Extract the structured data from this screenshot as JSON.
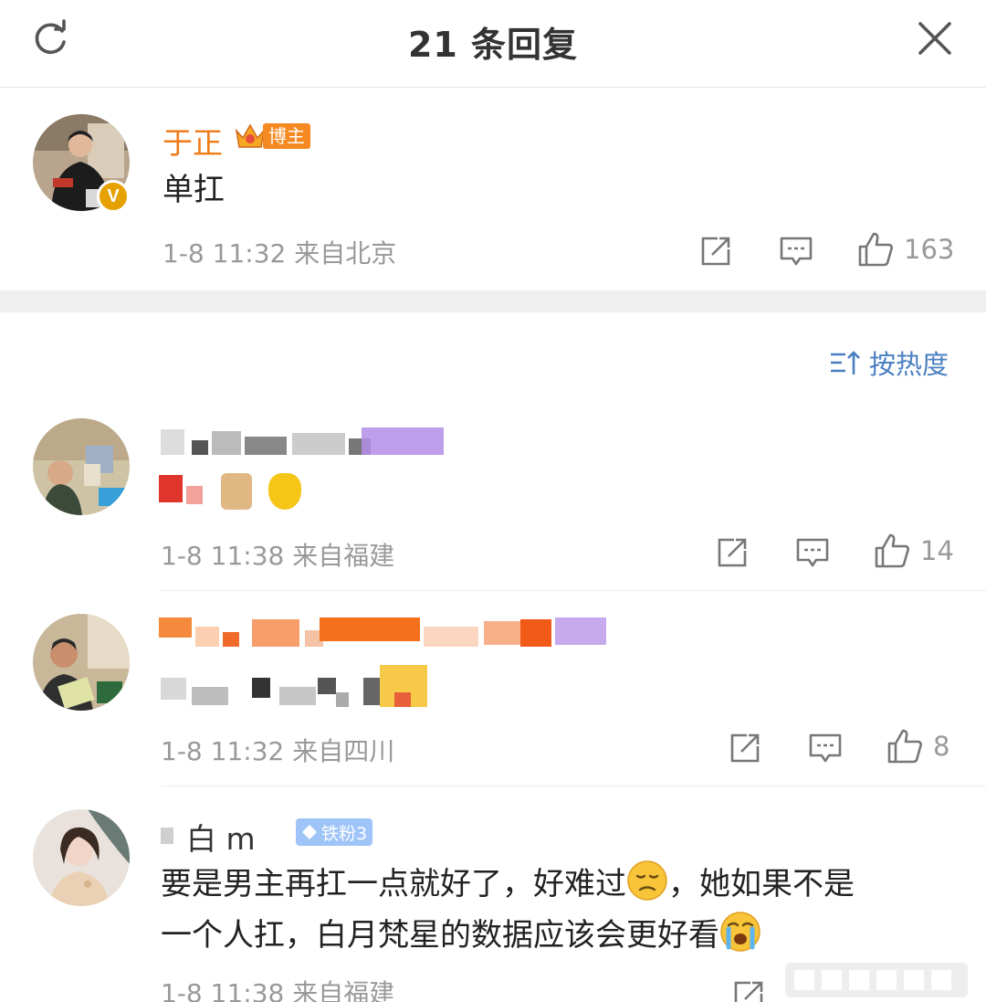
{
  "header": {
    "title": "21 条回复",
    "refresh_icon": "refresh-icon",
    "close_icon": "close-icon"
  },
  "main_comment": {
    "username": "于正",
    "badge": "博主",
    "verified_mark": "V",
    "text": "单扛",
    "meta": "1-8 11:32  来自北京",
    "likes": "163"
  },
  "sort": {
    "label": "按热度"
  },
  "replies": [
    {
      "meta": "1-8 11:38  来自福建",
      "likes": "14"
    },
    {
      "meta": "1-8 11:32  来自四川",
      "likes": "8"
    },
    {
      "username": "白 m",
      "badge": "铁粉3",
      "text_line1": "要是男主再扛一点就好了，好难过",
      "text_line1_end": "，她如果不是",
      "text_line2": "一个人扛，白月梵星的数据应该会更好看",
      "meta": "1-8 11:38  来自福建"
    }
  ],
  "colors": {
    "accent_blue": "#4a7fc1",
    "username_orange": "#f07a18",
    "meta_gray": "#999999"
  }
}
